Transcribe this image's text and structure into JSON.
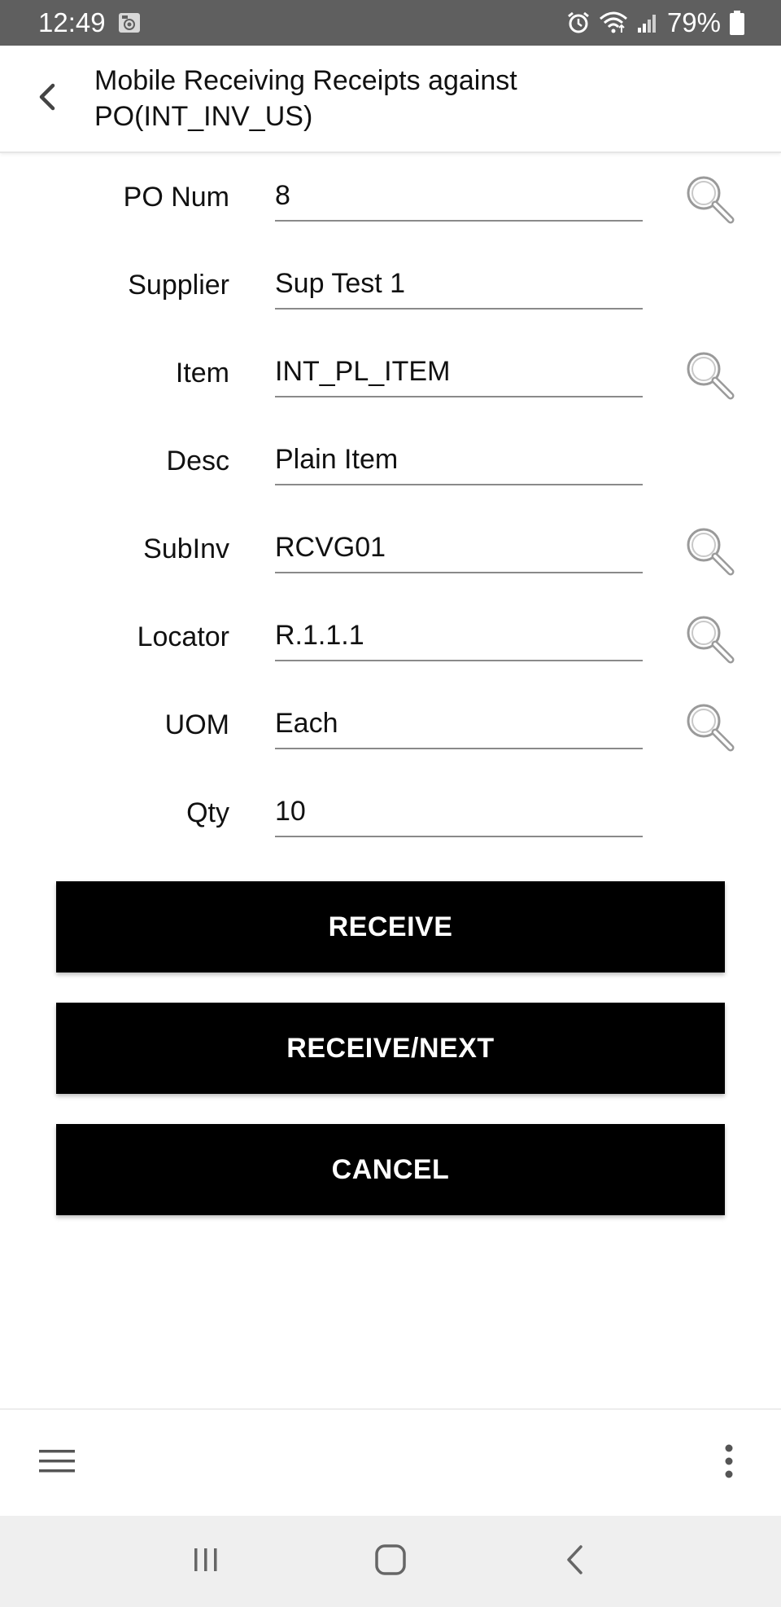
{
  "status_bar": {
    "time": "12:49",
    "battery": "79%",
    "icons": [
      "gallery-icon",
      "alarm-icon",
      "wifi-icon",
      "signal-icon",
      "battery-icon"
    ]
  },
  "header": {
    "title": "Mobile Receiving Receipts against PO(INT_INV_US)",
    "back_icon": "chevron-left-icon"
  },
  "form": {
    "fields": [
      {
        "label": "PO Num",
        "value": "8",
        "has_lookup": true
      },
      {
        "label": "Supplier",
        "value": "Sup Test 1",
        "has_lookup": false
      },
      {
        "label": "Item",
        "value": "INT_PL_ITEM",
        "has_lookup": true
      },
      {
        "label": "Desc",
        "value": "Plain Item",
        "has_lookup": false
      },
      {
        "label": "SubInv",
        "value": "RCVG01",
        "has_lookup": true
      },
      {
        "label": "Locator",
        "value": "R.1.1.1",
        "has_lookup": true
      },
      {
        "label": "UOM",
        "value": "Each",
        "has_lookup": true
      },
      {
        "label": "Qty",
        "value": "10",
        "has_lookup": false
      }
    ]
  },
  "actions": {
    "receive": "RECEIVE",
    "receive_next": "RECEIVE/NEXT",
    "cancel": "CANCEL"
  },
  "toolbar": {
    "menu_icon": "hamburger-menu-icon",
    "more_icon": "more-vertical-icon"
  },
  "nav_bar": {
    "icons": [
      "recent-apps-icon",
      "home-icon",
      "back-icon"
    ]
  },
  "colors": {
    "status_bar": "#5f5f5f",
    "button_bg": "#000000",
    "button_text": "#ffffff",
    "nav_bar": "#efefef",
    "icon_gray": "#8a8a8a"
  }
}
